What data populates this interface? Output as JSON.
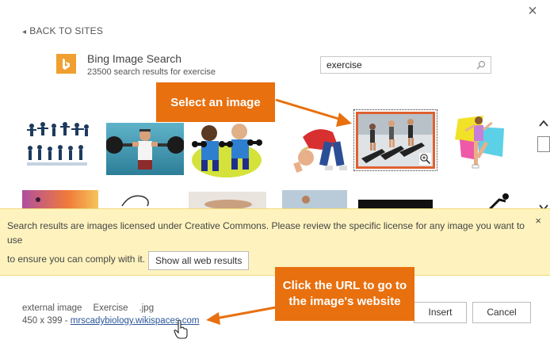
{
  "dialog": {
    "close_glyph": "×",
    "back_label": "BACK TO SITES"
  },
  "provider": {
    "icon": "bing-logo-icon",
    "name": "Bing Image Search",
    "result_summary": "23500 search results for exercise"
  },
  "search": {
    "value": "exercise",
    "icon": "search-icon"
  },
  "callouts": {
    "select_image": "Select an image",
    "click_url_line1": "Click the URL to go to",
    "click_url_line2": "the image's website"
  },
  "results": {
    "row1": [
      {
        "name": "athletes-silhouettes-image"
      },
      {
        "name": "weightlifter-image"
      },
      {
        "name": "cartoon-dumbbells-image"
      },
      {
        "name": "child-stretching-image"
      },
      {
        "name": "treadmill-runners-image",
        "selected": true
      },
      {
        "name": "aerobics-woman-image"
      }
    ],
    "row2": [
      {
        "name": "sunset-runner-image"
      },
      {
        "name": "sketch-image"
      },
      {
        "name": "woman-exercising-image"
      },
      {
        "name": "man-stretching-image"
      },
      {
        "name": "dark-thumbnail-image"
      },
      {
        "name": "cartoon-figure-image"
      }
    ]
  },
  "banner": {
    "text_line1": "Search results are images licensed under Creative Commons. Please review the specific license for any image you want to use",
    "text_line2": "to ensure you can comply with it.",
    "show_all_label": "Show all web results",
    "close_glyph": "×"
  },
  "footer": {
    "source": "external image",
    "title": "Exercise",
    "extension": ".jpg",
    "dimensions": "450 x 399 -",
    "url": "mrscadybiology.wikispaces.com",
    "insert_label": "Insert",
    "cancel_label": "Cancel"
  },
  "colors": {
    "accent_orange": "#e8700f",
    "bing_orange": "#f0a030",
    "banner_bg": "#fef3be",
    "link_blue": "#2a5599",
    "selection_border": "#e06030"
  }
}
